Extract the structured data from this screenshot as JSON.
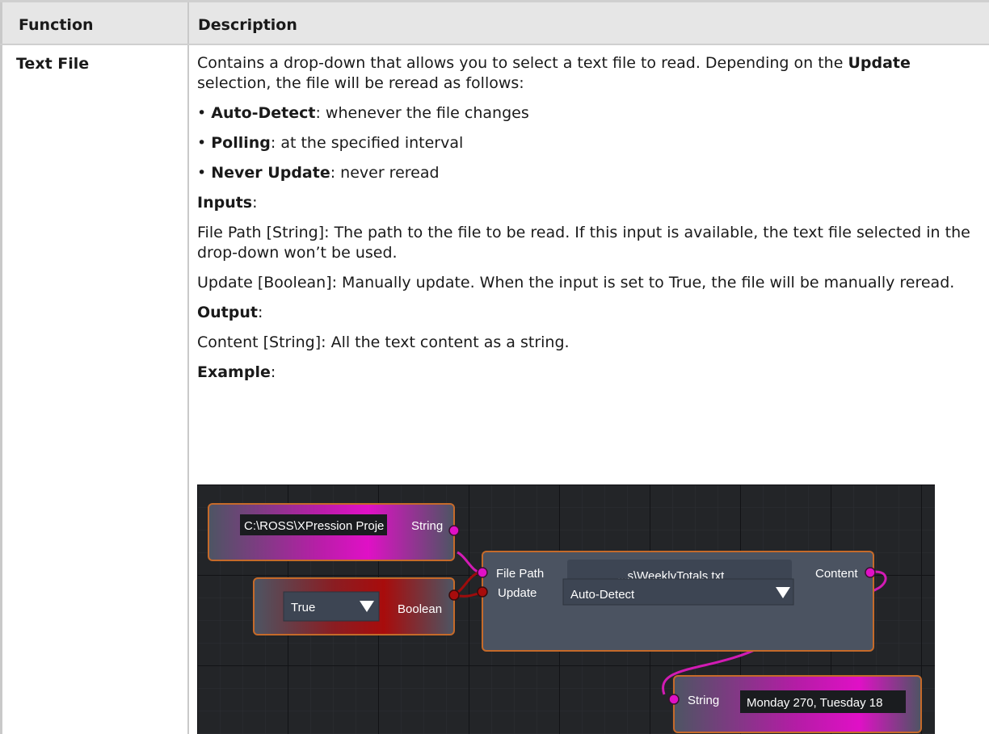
{
  "header": {
    "col1": "Function",
    "col2": "Description"
  },
  "row": {
    "function": "Text File",
    "intro_1": "Contains a drop-down that allows you to select a text file to read. Depending on the ",
    "intro_bold": "Update",
    "intro_2": " selection, the file will be reread as follows:",
    "bullets": [
      {
        "term": "Auto-Detect",
        "text": ": whenever the file changes"
      },
      {
        "term": "Polling",
        "text": ": at the specified interval"
      },
      {
        "term": "Never Update",
        "text": ": never reread"
      }
    ],
    "inputs_heading": "Inputs",
    "inputs_colon": ":",
    "input_1": "File Path [String]: The path to the file to be read. If this input is available, the text file selected in the drop-down won’t be used.",
    "input_2": "Update [Boolean]: Manually update. When the input is set to True, the file will be manually reread.",
    "output_heading": "Output",
    "output_colon": ":",
    "output_1": "Content [String]: All the text content as a string.",
    "example_heading": "Example",
    "example_colon": ":"
  },
  "example": {
    "string_node": {
      "value": "C:\\ROSS\\XPression Proje",
      "port_label": "String"
    },
    "boolean_node": {
      "value": "True",
      "port_label": "Boolean",
      "dropdown_icon": "triangle-down-icon"
    },
    "textfile_node": {
      "file_path_label": "File Path",
      "file_path_value": "...s\\WeeklyTotals.txt",
      "update_label": "Update",
      "update_value": "Auto-Detect",
      "content_label": "Content",
      "dropdown_icon": "triangle-down-icon"
    },
    "output_node": {
      "port_label": "String",
      "value": "Monday 270, Tuesday 18"
    },
    "colors": {
      "string_wire": "#d21bb4",
      "boolean_wire": "#9e0c0c",
      "node_border": "#c56a2a",
      "node_bg": "#4b5361",
      "canvas_bg": "#232528"
    }
  }
}
